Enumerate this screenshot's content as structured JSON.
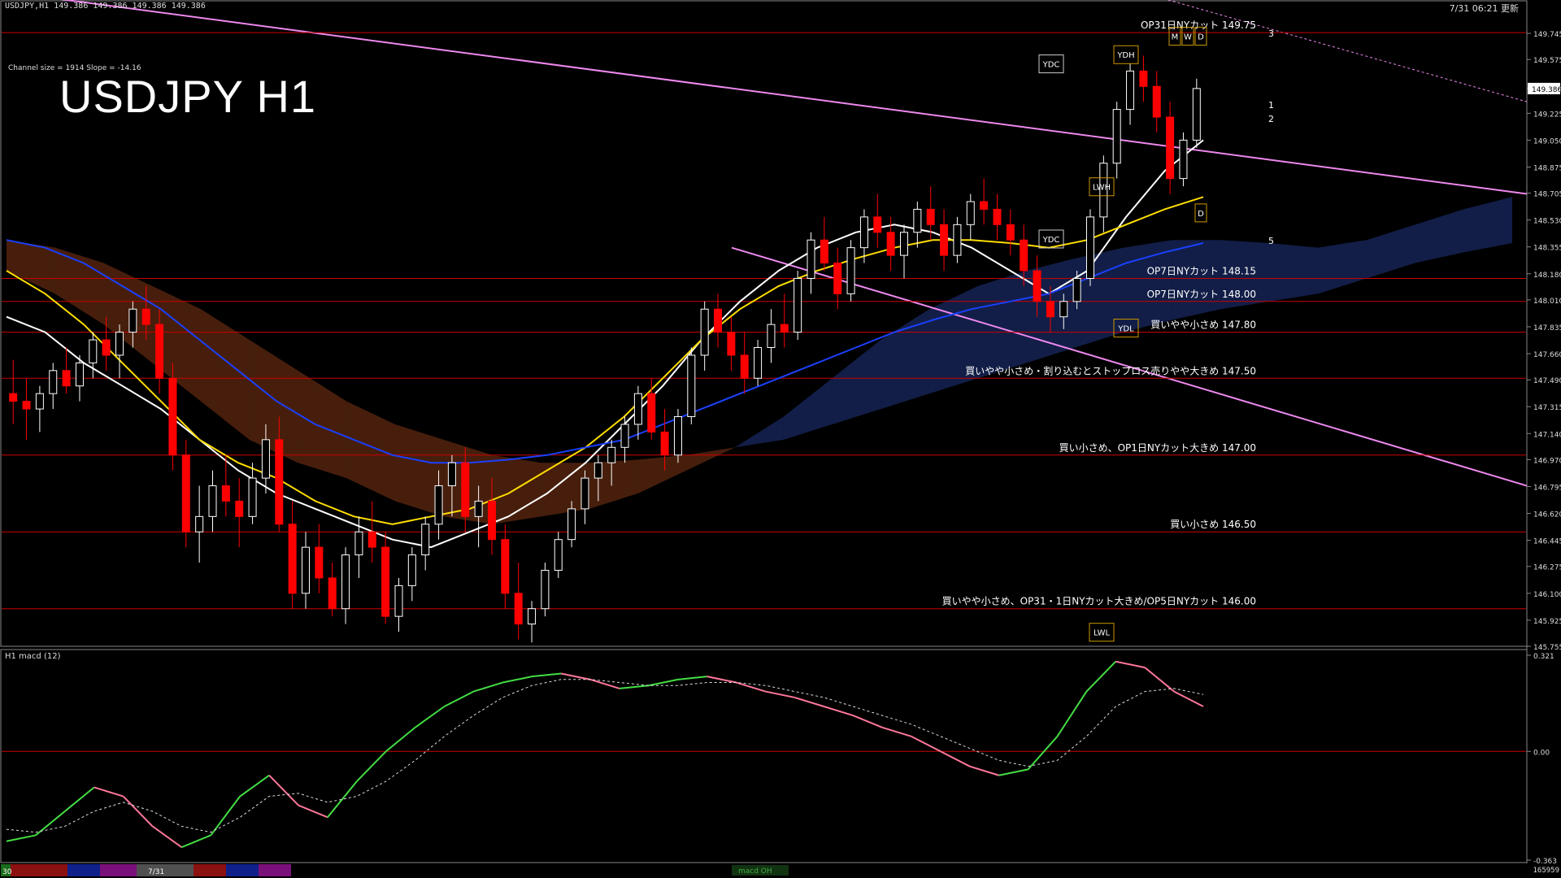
{
  "header": {
    "symbol_info": "USDJPY,H1  149.386 149.386 149.386 149.386",
    "datetime": "7/31 06:21 更新"
  },
  "channel_info": "Channel size = 1914 Slope = -14.16",
  "title": "USDJPY H1",
  "macd_title": "H1  macd (12)",
  "footer": {
    "left_label": "30",
    "date_label": "7/31",
    "center_label": "macd OH",
    "count": "165959"
  },
  "colors": {
    "background": "#000000",
    "bull": "#ffffff",
    "bear": "#ff0000",
    "tenkan": "#ffffff",
    "kijun": "#ffdd00",
    "ma_long": "#1a40ff",
    "chikou": "#22cc22",
    "channel": "#ee88ee",
    "level": "#cc0000",
    "kumo_bull": "#3355cc",
    "kumo_bear": "#cc5522"
  },
  "chart_data": [
    {
      "type": "candlestick",
      "title": "USDJPY H1",
      "x_label": "",
      "y_label": "",
      "ylim": [
        145.755,
        149.92
      ],
      "y_ticks": [
        149.745,
        149.575,
        149.386,
        149.225,
        149.05,
        148.875,
        148.705,
        148.53,
        148.355,
        148.18,
        148.01,
        147.835,
        147.66,
        147.49,
        147.315,
        147.14,
        146.97,
        146.795,
        146.62,
        146.445,
        146.275,
        146.1,
        145.925,
        145.755
      ],
      "current_price": 149.386,
      "bars": 200,
      "levels": [
        {
          "price": 149.75,
          "label": "OP31日NYカット 149.75"
        },
        {
          "price": 148.15,
          "label": "OP7日NYカット 148.15"
        },
        {
          "price": 148.0,
          "label": "OP7日NYカット 148.00"
        },
        {
          "price": 147.8,
          "label": "買いやや小さめ 147.80"
        },
        {
          "price": 147.5,
          "label": "買いやや小さめ・割り込むとストップロス売りやや大きめ 147.50"
        },
        {
          "price": 147.0,
          "label": "買い小さめ、OP1日NYカット大きめ 147.00"
        },
        {
          "price": 146.5,
          "label": "買い小さめ 146.50"
        },
        {
          "price": 146.0,
          "label": "買いやや小さめ、OP31・1日NYカット大きめ/OP5日NYカット 146.00"
        }
      ],
      "box_labels": [
        {
          "text": "YDC",
          "price": 149.52
        },
        {
          "text": "YDC",
          "price": 148.38
        },
        {
          "text": "YDH",
          "price": 149.58
        },
        {
          "text": "YDL",
          "price": 147.8
        },
        {
          "text": "LWH",
          "price": 148.72
        },
        {
          "text": "LWL",
          "price": 145.82
        },
        {
          "text": "M",
          "price": 149.7
        },
        {
          "text": "W",
          "price": 149.7
        },
        {
          "text": "D",
          "price": 149.7
        },
        {
          "text": "D",
          "price": 148.55
        }
      ],
      "projection_labels": [
        "3",
        "1",
        "2",
        "5"
      ],
      "candles": [
        [
          147.4,
          147.62,
          147.2,
          147.35
        ],
        [
          147.35,
          147.5,
          147.1,
          147.3
        ],
        [
          147.3,
          147.45,
          147.15,
          147.4
        ],
        [
          147.4,
          147.6,
          147.3,
          147.55
        ],
        [
          147.55,
          147.7,
          147.4,
          147.45
        ],
        [
          147.45,
          147.65,
          147.35,
          147.6
        ],
        [
          147.6,
          147.8,
          147.5,
          147.75
        ],
        [
          147.75,
          147.9,
          147.55,
          147.65
        ],
        [
          147.65,
          147.85,
          147.5,
          147.8
        ],
        [
          147.8,
          148.0,
          147.7,
          147.95
        ],
        [
          147.95,
          148.1,
          147.75,
          147.85
        ],
        [
          147.85,
          147.95,
          147.4,
          147.5
        ],
        [
          147.5,
          147.6,
          146.9,
          147.0
        ],
        [
          147.0,
          147.1,
          146.4,
          146.5
        ],
        [
          146.5,
          146.8,
          146.3,
          146.6
        ],
        [
          146.6,
          146.9,
          146.5,
          146.8
        ],
        [
          146.8,
          147.0,
          146.6,
          146.7
        ],
        [
          146.7,
          146.85,
          146.4,
          146.6
        ],
        [
          146.6,
          146.95,
          146.55,
          146.85
        ],
        [
          146.85,
          147.2,
          146.75,
          147.1
        ],
        [
          147.1,
          147.25,
          146.5,
          146.55
        ],
        [
          146.55,
          146.7,
          146.0,
          146.1
        ],
        [
          146.1,
          146.5,
          146.0,
          146.4
        ],
        [
          146.4,
          146.55,
          146.1,
          146.2
        ],
        [
          146.2,
          146.3,
          145.95,
          146.0
        ],
        [
          146.0,
          146.4,
          145.9,
          146.35
        ],
        [
          146.35,
          146.6,
          146.2,
          146.5
        ],
        [
          146.5,
          146.7,
          146.3,
          146.4
        ],
        [
          146.4,
          146.5,
          145.9,
          145.95
        ],
        [
          145.95,
          146.2,
          145.85,
          146.15
        ],
        [
          146.15,
          146.4,
          146.05,
          146.35
        ],
        [
          146.35,
          146.6,
          146.25,
          146.55
        ],
        [
          146.55,
          146.9,
          146.45,
          146.8
        ],
        [
          146.8,
          147.0,
          146.6,
          146.95
        ],
        [
          146.95,
          147.05,
          146.5,
          146.6
        ],
        [
          146.6,
          146.8,
          146.4,
          146.7
        ],
        [
          146.7,
          146.85,
          146.35,
          146.45
        ],
        [
          146.45,
          146.55,
          146.0,
          146.1
        ],
        [
          146.1,
          146.3,
          145.8,
          145.9
        ],
        [
          145.9,
          146.05,
          145.78,
          146.0
        ],
        [
          146.0,
          146.3,
          145.95,
          146.25
        ],
        [
          146.25,
          146.5,
          146.2,
          146.45
        ],
        [
          146.45,
          146.7,
          146.4,
          146.65
        ],
        [
          146.65,
          146.9,
          146.55,
          146.85
        ],
        [
          146.85,
          147.0,
          146.7,
          146.95
        ],
        [
          146.95,
          147.1,
          146.8,
          147.05
        ],
        [
          147.05,
          147.25,
          146.95,
          147.2
        ],
        [
          147.2,
          147.45,
          147.1,
          147.4
        ],
        [
          147.4,
          147.5,
          147.1,
          147.15
        ],
        [
          147.15,
          147.3,
          146.9,
          147.0
        ],
        [
          147.0,
          147.3,
          146.95,
          147.25
        ],
        [
          147.25,
          147.7,
          147.2,
          147.65
        ],
        [
          147.65,
          148.0,
          147.55,
          147.95
        ],
        [
          147.95,
          148.05,
          147.7,
          147.8
        ],
        [
          147.8,
          147.9,
          147.55,
          147.65
        ],
        [
          147.65,
          147.8,
          147.4,
          147.5
        ],
        [
          147.5,
          147.75,
          147.45,
          147.7
        ],
        [
          147.7,
          147.95,
          147.6,
          147.85
        ],
        [
          147.85,
          148.05,
          147.7,
          147.8
        ],
        [
          147.8,
          148.2,
          147.75,
          148.15
        ],
        [
          148.15,
          148.45,
          148.05,
          148.4
        ],
        [
          148.4,
          148.55,
          148.2,
          148.25
        ],
        [
          148.25,
          148.35,
          147.95,
          148.05
        ],
        [
          148.05,
          148.4,
          148.0,
          148.35
        ],
        [
          148.35,
          148.6,
          148.25,
          148.55
        ],
        [
          148.55,
          148.7,
          148.35,
          148.45
        ],
        [
          148.45,
          148.55,
          148.2,
          148.3
        ],
        [
          148.3,
          148.5,
          148.15,
          148.45
        ],
        [
          148.45,
          148.65,
          148.35,
          148.6
        ],
        [
          148.6,
          148.75,
          148.4,
          148.5
        ],
        [
          148.5,
          148.6,
          148.2,
          148.3
        ],
        [
          148.3,
          148.55,
          148.25,
          148.5
        ],
        [
          148.5,
          148.7,
          148.4,
          148.65
        ],
        [
          148.65,
          148.8,
          148.5,
          148.6
        ],
        [
          148.6,
          148.7,
          148.4,
          148.5
        ],
        [
          148.5,
          148.6,
          148.3,
          148.4
        ],
        [
          148.4,
          148.5,
          148.1,
          148.2
        ],
        [
          148.2,
          148.3,
          147.9,
          148.0
        ],
        [
          148.0,
          148.1,
          147.8,
          147.9
        ],
        [
          147.9,
          148.05,
          147.82,
          148.0
        ],
        [
          148.0,
          148.2,
          147.95,
          148.15
        ],
        [
          148.15,
          148.6,
          148.1,
          148.55
        ],
        [
          148.55,
          148.95,
          148.45,
          148.9
        ],
        [
          148.9,
          149.3,
          148.8,
          149.25
        ],
        [
          149.25,
          149.55,
          149.15,
          149.5
        ],
        [
          149.5,
          149.6,
          149.3,
          149.4
        ],
        [
          149.4,
          149.5,
          149.1,
          149.2
        ],
        [
          149.2,
          149.3,
          148.7,
          148.8
        ],
        [
          148.8,
          149.1,
          148.75,
          149.05
        ],
        [
          149.05,
          149.45,
          149.0,
          149.386
        ]
      ],
      "moving_averages": [
        {
          "name": "tenkan",
          "values": [
            147.9,
            147.8,
            147.6,
            147.45,
            147.3,
            147.1,
            146.9,
            146.75,
            146.65,
            146.55,
            146.45,
            146.4,
            146.5,
            146.6,
            146.75,
            146.95,
            147.2,
            147.45,
            147.75,
            148.0,
            148.2,
            148.35,
            148.45,
            148.5,
            148.45,
            148.35,
            148.2,
            148.05,
            148.2,
            148.55,
            148.85,
            149.05
          ]
        },
        {
          "name": "kijun",
          "values": [
            148.2,
            148.05,
            147.85,
            147.6,
            147.35,
            147.1,
            146.95,
            146.85,
            146.7,
            146.6,
            146.55,
            146.6,
            146.65,
            146.75,
            146.9,
            147.05,
            147.25,
            147.5,
            147.75,
            147.95,
            148.1,
            148.2,
            148.28,
            148.35,
            148.4,
            148.4,
            148.38,
            148.35,
            148.4,
            148.5,
            148.6,
            148.68
          ]
        },
        {
          "name": "ma_long",
          "values": [
            148.4,
            148.35,
            148.25,
            148.1,
            147.95,
            147.75,
            147.55,
            147.35,
            147.2,
            147.1,
            147.0,
            146.95,
            146.95,
            146.97,
            147.0,
            147.05,
            147.1,
            147.2,
            147.3,
            147.4,
            147.5,
            147.6,
            147.7,
            147.8,
            147.88,
            147.95,
            148.0,
            148.05,
            148.15,
            148.25,
            148.32,
            148.38
          ]
        }
      ]
    },
    {
      "type": "line",
      "title": "H1  macd (12)",
      "x_label": "",
      "y_label": "",
      "ylim": [
        -0.363,
        0.321
      ],
      "y_ticks": [
        0.321,
        0.0,
        -0.363
      ],
      "series": [
        {
          "name": "macd",
          "values": [
            -0.3,
            -0.28,
            -0.2,
            -0.12,
            -0.15,
            -0.25,
            -0.32,
            -0.28,
            -0.15,
            -0.08,
            -0.18,
            -0.22,
            -0.1,
            0.0,
            0.08,
            0.15,
            0.2,
            0.23,
            0.25,
            0.26,
            0.24,
            0.21,
            0.22,
            0.24,
            0.25,
            0.23,
            0.2,
            0.18,
            0.15,
            0.12,
            0.08,
            0.05,
            0.0,
            -0.05,
            -0.08,
            -0.06,
            0.05,
            0.2,
            0.3,
            0.28,
            0.2,
            0.15
          ]
        },
        {
          "name": "signal",
          "values": [
            -0.26,
            -0.27,
            -0.25,
            -0.2,
            -0.17,
            -0.2,
            -0.25,
            -0.27,
            -0.22,
            -0.15,
            -0.14,
            -0.17,
            -0.15,
            -0.1,
            -0.03,
            0.05,
            0.12,
            0.18,
            0.22,
            0.24,
            0.24,
            0.23,
            0.22,
            0.22,
            0.23,
            0.23,
            0.22,
            0.2,
            0.18,
            0.15,
            0.12,
            0.09,
            0.05,
            0.01,
            -0.03,
            -0.05,
            -0.03,
            0.05,
            0.15,
            0.2,
            0.21,
            0.19
          ]
        }
      ]
    }
  ]
}
